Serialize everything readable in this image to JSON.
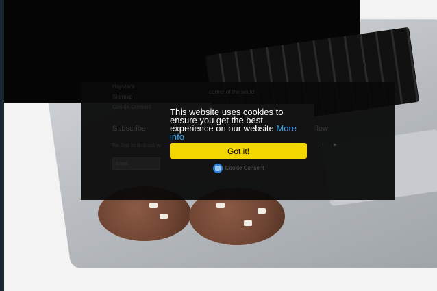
{
  "footer": {
    "links": [
      "Haystack",
      "Sitemap",
      "Cookie Consent"
    ],
    "subscribe_heading": "Subscribe",
    "subscribe_text": "Be first to find out w",
    "email_placeholder": "Email",
    "follow_heading": "llow",
    "corner_text": "corner of the world"
  },
  "consent": {
    "message": "This website uses cookies to ensure you get the best experience on our website",
    "more_info_label": "More info",
    "button_label": "Got it!",
    "powered_label": "Cookie Consent"
  },
  "colors": {
    "button": "#f1d600",
    "link": "#31a8f0",
    "popup_bg": "#131313"
  }
}
